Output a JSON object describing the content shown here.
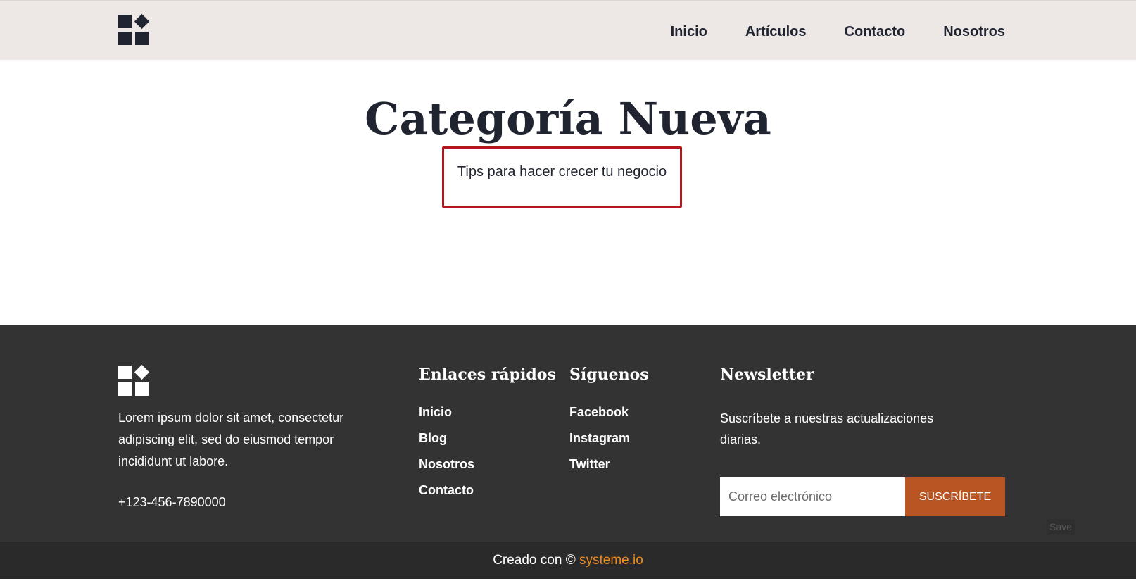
{
  "header": {
    "logo_icon": "brand-blocks-icon",
    "nav": [
      "Inicio",
      "Artículos",
      "Contacto",
      "Nosotros"
    ]
  },
  "main": {
    "title": "Categoría Nueva",
    "subtitle": "Tips para hacer crecer tu negocio",
    "highlight_color": "#b3161c"
  },
  "footer": {
    "logo_icon": "brand-blocks-icon",
    "about": "Lorem ipsum dolor sit amet, consectetur adipiscing elit, sed do eiusmod tempor incididunt ut labore.",
    "phone": "+123-456-7890000",
    "quick_links": {
      "title": "Enlaces rápidos",
      "items": [
        "Inicio",
        "Blog",
        "Nosotros",
        "Contacto"
      ]
    },
    "social": {
      "title": "Síguenos",
      "items": [
        "Facebook",
        "Instagram",
        "Twitter"
      ]
    },
    "newsletter": {
      "title": "Newsletter",
      "text": "Suscríbete a nuestras actualizaciones diarias.",
      "placeholder": "Correo electrónico",
      "button": "SUSCRÍBETE",
      "button_color": "#b85522"
    },
    "save_label": "Save"
  },
  "bottom_bar": {
    "prefix": "Creado con © ",
    "link": "systeme.io",
    "link_color": "#f08a1d"
  }
}
